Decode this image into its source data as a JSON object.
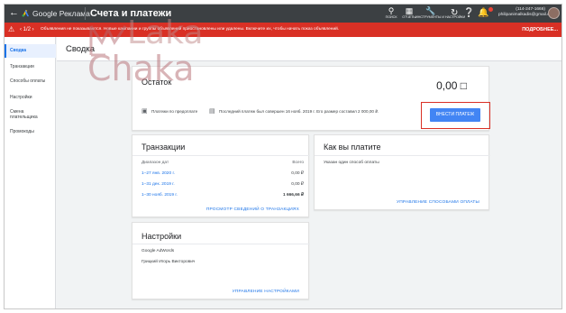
{
  "topbar": {
    "back_icon": "arrow-back-icon",
    "brand": "Google Реклама",
    "page": "Счета и платежи",
    "tools": [
      {
        "icon": "search-icon",
        "label": "ПОИСК"
      },
      {
        "icon": "reports-icon",
        "label": "ОТЧЕТЫ"
      },
      {
        "icon": "wrench-icon",
        "label": "ИНСТРУМЕНТЫ И НАСТРОЙКИ"
      }
    ],
    "account_id": "(114-247-1666)",
    "account_email": "philipanimalkadis@gmail.com"
  },
  "alert": {
    "pager": "1/2",
    "text": "Объявления не показываются. Новые кампании и группы объявлений приостановлены или удалены. Включите их, чтобы начать показ объявлений.",
    "more": "ПОДРОБНЕЕ..."
  },
  "sidebar": {
    "items": [
      {
        "label": "Сводка"
      },
      {
        "label": "Транзакции"
      },
      {
        "label": "Способы оплаты"
      },
      {
        "label": "Настройки"
      },
      {
        "label": "Смена плательщика"
      },
      {
        "label": "Промокоды"
      }
    ]
  },
  "page_title": "Сводка",
  "balance": {
    "title": "Остаток",
    "amount": "0,00 □",
    "prepaid": "Платежи по предоплате",
    "last_payment": "Последний платеж был совершен 16 нояб. 2019 г. Его размер составил 2 000,00 ₽.",
    "pay_button": "ВНЕСТИ ПЛАТЕЖ"
  },
  "transactions": {
    "title": "Транзакции",
    "col_range": "Диапазон дат",
    "col_total": "Всего",
    "rows": [
      {
        "range": "1–27 янв. 2020 г.",
        "total": "0,00 ₽"
      },
      {
        "range": "1–31 дек. 2019 г.",
        "total": "0,00 ₽"
      },
      {
        "range": "1–30 нояб. 2019 г.",
        "total": "1 666,66 ₽"
      }
    ],
    "link": "ПРОСМОТР СВЕДЕНИЙ О ТРАНЗАКЦИЯХ"
  },
  "payment_method": {
    "title": "Как вы платите",
    "text": "Указан один способ оплаты",
    "link": "УПРАВЛЕНИЕ СПОСОБАМИ ОПЛАТЫ"
  },
  "settings": {
    "title": "Настройки",
    "line1": "Google AdWords",
    "line2": "Грицкий Игорь Викторович",
    "link": "УПРАВЛЕНИЕ НАСТРОЙКАМИ"
  },
  "watermark": {
    "line1": "Laka",
    "line2": "Chaka"
  },
  "colors": {
    "topbar": "#3c4043",
    "alert": "#d93025",
    "accent": "#1a73e8",
    "button": "#4285f4",
    "highlight": "#d93025"
  }
}
